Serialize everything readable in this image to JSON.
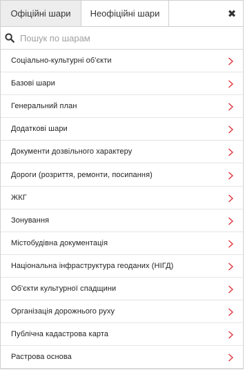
{
  "tabs": [
    {
      "label": "Офіційні шари",
      "active": true
    },
    {
      "label": "Неофіційні шари",
      "active": false
    }
  ],
  "close_label": "✖",
  "search": {
    "placeholder": "Пошук по шарам",
    "value": ""
  },
  "colors": {
    "accent": "#e0323a",
    "active_tab_bg": "#ededed",
    "border": "#cfcfcf"
  },
  "layers": [
    {
      "label": "Соціально-культурні об'єкти"
    },
    {
      "label": "Базові шари"
    },
    {
      "label": "Генеральний план"
    },
    {
      "label": "Додаткові шари"
    },
    {
      "label": "Документи дозвільного характеру"
    },
    {
      "label": "Дороги (розриття, ремонти, посипання)"
    },
    {
      "label": "ЖКГ"
    },
    {
      "label": "Зонування"
    },
    {
      "label": "Містобудівна документація"
    },
    {
      "label": "Національна інфраструктура геоданих (НІГД)"
    },
    {
      "label": "Об'єкти культурної спадщини"
    },
    {
      "label": "Організація дорожнього руху"
    },
    {
      "label": "Публічна кадастрова карта"
    },
    {
      "label": "Растрова основа"
    }
  ]
}
